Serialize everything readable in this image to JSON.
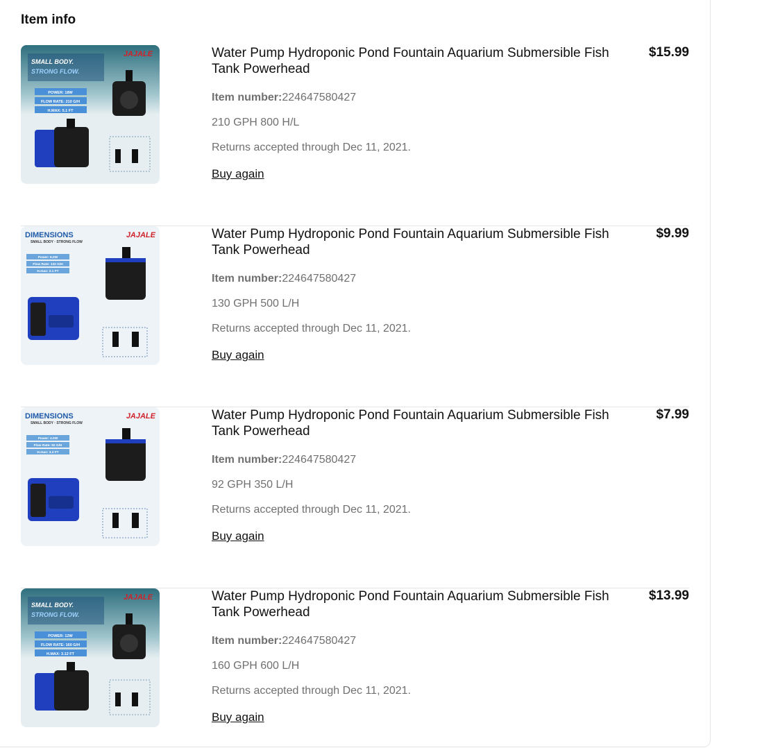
{
  "section_title": "Item info",
  "items": [
    {
      "title": "Water Pump Hydroponic Pond Fountain Aquarium Submersible Fish Tank Powerhead",
      "price": "$15.99",
      "item_number_label": "Item number:",
      "item_number": "224647580427",
      "variant": "210 GPH 800 H/L",
      "returns": "Returns accepted through Dec 11, 2021.",
      "buy_again": "Buy again",
      "image": {
        "style": "wave",
        "brand": "JAJALE",
        "headline1": "SMALL BODY.",
        "headline2": "STRONG FLOW.",
        "spec1": "POWER: 18W",
        "spec2": "FLOW RATE: 210 G/H",
        "spec3": "H.MAX: 5.1 FT"
      }
    },
    {
      "title": "Water Pump Hydroponic Pond Fountain Aquarium Submersible Fish Tank Powerhead",
      "price": "$9.99",
      "item_number_label": "Item number:",
      "item_number": "224647580427",
      "variant": "130 GPH 500 L/H",
      "returns": "Returns accepted through Dec 11, 2021.",
      "buy_again": "Buy again",
      "image": {
        "style": "dimensions",
        "brand": "JAJALE",
        "headline1": "DIMENSIONS",
        "headline2": "SMALL BODY · STRONG FLOW",
        "spec1": "Power: 6.0W",
        "spec2": "Flow Rate: 132 G/H",
        "spec3": "H.max: 2.1 FT"
      }
    },
    {
      "title": "Water Pump Hydroponic Pond Fountain Aquarium Submersible Fish Tank Powerhead",
      "price": "$7.99",
      "item_number_label": "Item number:",
      "item_number": "224647580427",
      "variant": "92 GPH 350 L/H",
      "returns": "Returns accepted through Dec 11, 2021.",
      "buy_again": "Buy again",
      "image": {
        "style": "dimensions",
        "brand": "JAJALE",
        "headline1": "DIMENSIONS",
        "headline2": "SMALL BODY · STRONG FLOW",
        "spec1": "Power: 4.0W",
        "spec2": "Flow Rate: 92 G/H",
        "spec3": "H.max: 3.3 FT"
      }
    },
    {
      "title": "Water Pump Hydroponic Pond Fountain Aquarium Submersible Fish Tank Powerhead",
      "price": "$13.99",
      "item_number_label": "Item number:",
      "item_number": "224647580427",
      "variant": "160 GPH 600 L/H",
      "returns": "Returns accepted through Dec 11, 2021.",
      "buy_again": "Buy again",
      "image": {
        "style": "wave",
        "brand": "JAJALE",
        "headline1": "SMALL BODY.",
        "headline2": "STRONG FLOW.",
        "spec1": "POWER: 12W",
        "spec2": "FLOW RATE: 160 G/H",
        "spec3": "H.MAX: 3.12 FT"
      }
    }
  ],
  "colors": {
    "brand_red": "#d0222a",
    "spec_blue": "#4a90d9",
    "pump_blue": "#1f3fbf",
    "pump_black": "#1c1c1c"
  }
}
